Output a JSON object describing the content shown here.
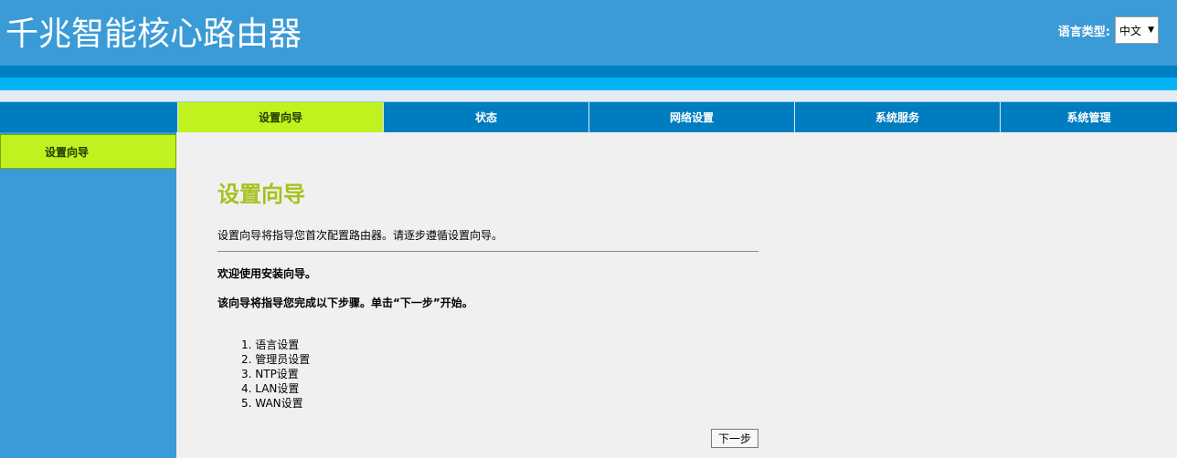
{
  "header": {
    "title": "千兆智能核心路由器",
    "language_label": "语言类型:",
    "language_selected": "中文"
  },
  "nav": {
    "tabs": [
      {
        "label": "设置向导",
        "active": true
      },
      {
        "label": "状态",
        "active": false
      },
      {
        "label": "网络设置",
        "active": false
      },
      {
        "label": "系统服务",
        "active": false
      },
      {
        "label": "系统管理",
        "active": false
      }
    ]
  },
  "sidebar": {
    "items": [
      {
        "label": "设置向导",
        "active": true
      }
    ]
  },
  "main": {
    "title": "设置向导",
    "description": "设置向导将指导您首次配置路由器。请逐步遵循设置向导。",
    "welcome": "欢迎使用安装向导。",
    "guide_text": "该向导将指导您完成以下步骤。单击“下一步”开始。",
    "steps": [
      "1. 语言设置",
      "2. 管理员设置",
      "3. NTP设置",
      "4. LAN设置",
      "5. WAN设置"
    ],
    "next_button": "下一步"
  },
  "colors": {
    "header_bg": "#3a9bd7",
    "nav_bg": "#007dc0",
    "active_green": "#bff21e",
    "title_green": "#a7c11b",
    "band_light": "#00b4f6"
  }
}
